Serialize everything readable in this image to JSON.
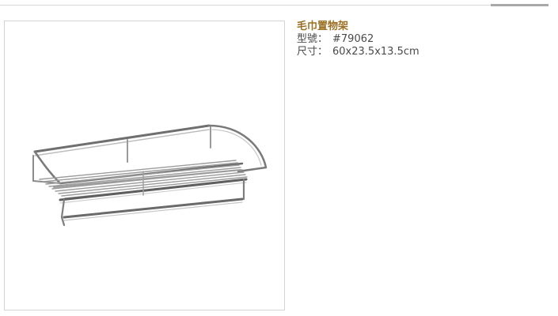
{
  "product": {
    "title": "毛巾置物架",
    "specs": [
      {
        "label": "型號：",
        "value": "#79062"
      },
      {
        "label": "尺寸：",
        "value": "60x23.5x13.5cm"
      }
    ],
    "image_icon": "towel-rack-product-photo"
  },
  "colors": {
    "title": "#9b7024",
    "text": "#4a4a4a",
    "frame_border": "#d4d4d4",
    "rule": "#d9d9d9"
  }
}
